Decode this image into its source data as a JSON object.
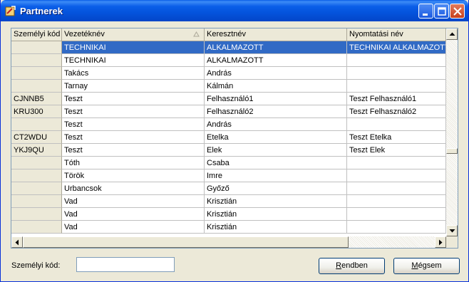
{
  "window": {
    "title": "Partnerek"
  },
  "grid": {
    "columns": [
      "Személyi kód",
      "Vezetéknév",
      "Keresztnév",
      "Nyomtatási név"
    ],
    "rows": [
      [
        "",
        "TECHNIKAI",
        "ALKALMAZOTT",
        "TECHNIKAI ALKALMAZOTT"
      ],
      [
        "",
        "TECHNIKAI",
        "ALKALMAZOTT",
        ""
      ],
      [
        "",
        "Takács",
        "András",
        ""
      ],
      [
        "",
        "Tarnay",
        "Kálmán",
        ""
      ],
      [
        "CJNNB5",
        "Teszt",
        "Felhasználó1",
        "Teszt Felhasználó1"
      ],
      [
        "KRU300",
        "Teszt",
        "Felhasználó2",
        "Teszt Felhasználó2"
      ],
      [
        "",
        "Teszt",
        "András",
        ""
      ],
      [
        "CT2WDU",
        "Teszt",
        "Etelka",
        "Teszt Etelka"
      ],
      [
        "YKJ9QU",
        "Teszt",
        "Elek",
        "Teszt Elek"
      ],
      [
        "",
        "Tóth",
        "Csaba",
        ""
      ],
      [
        "",
        "Török",
        "Imre",
        ""
      ],
      [
        "",
        "Urbancsok",
        "Győző",
        ""
      ],
      [
        "",
        "Vad",
        "Krisztián",
        ""
      ],
      [
        "",
        "Vad",
        "Krisztián",
        ""
      ],
      [
        "",
        "Vad",
        "Krisztián",
        ""
      ]
    ],
    "selected_row": 0,
    "sort_icon": "sort-ascending-icon"
  },
  "footer": {
    "code_label": "Személyi kód:",
    "code_value": "",
    "ok_button_prefix": "R",
    "ok_button_rest": "endben",
    "cancel_button_prefix": "M",
    "cancel_button_rest": "égsem"
  },
  "colors": {
    "selection": "#316ac5",
    "titlebar": "#0a5ee8"
  }
}
